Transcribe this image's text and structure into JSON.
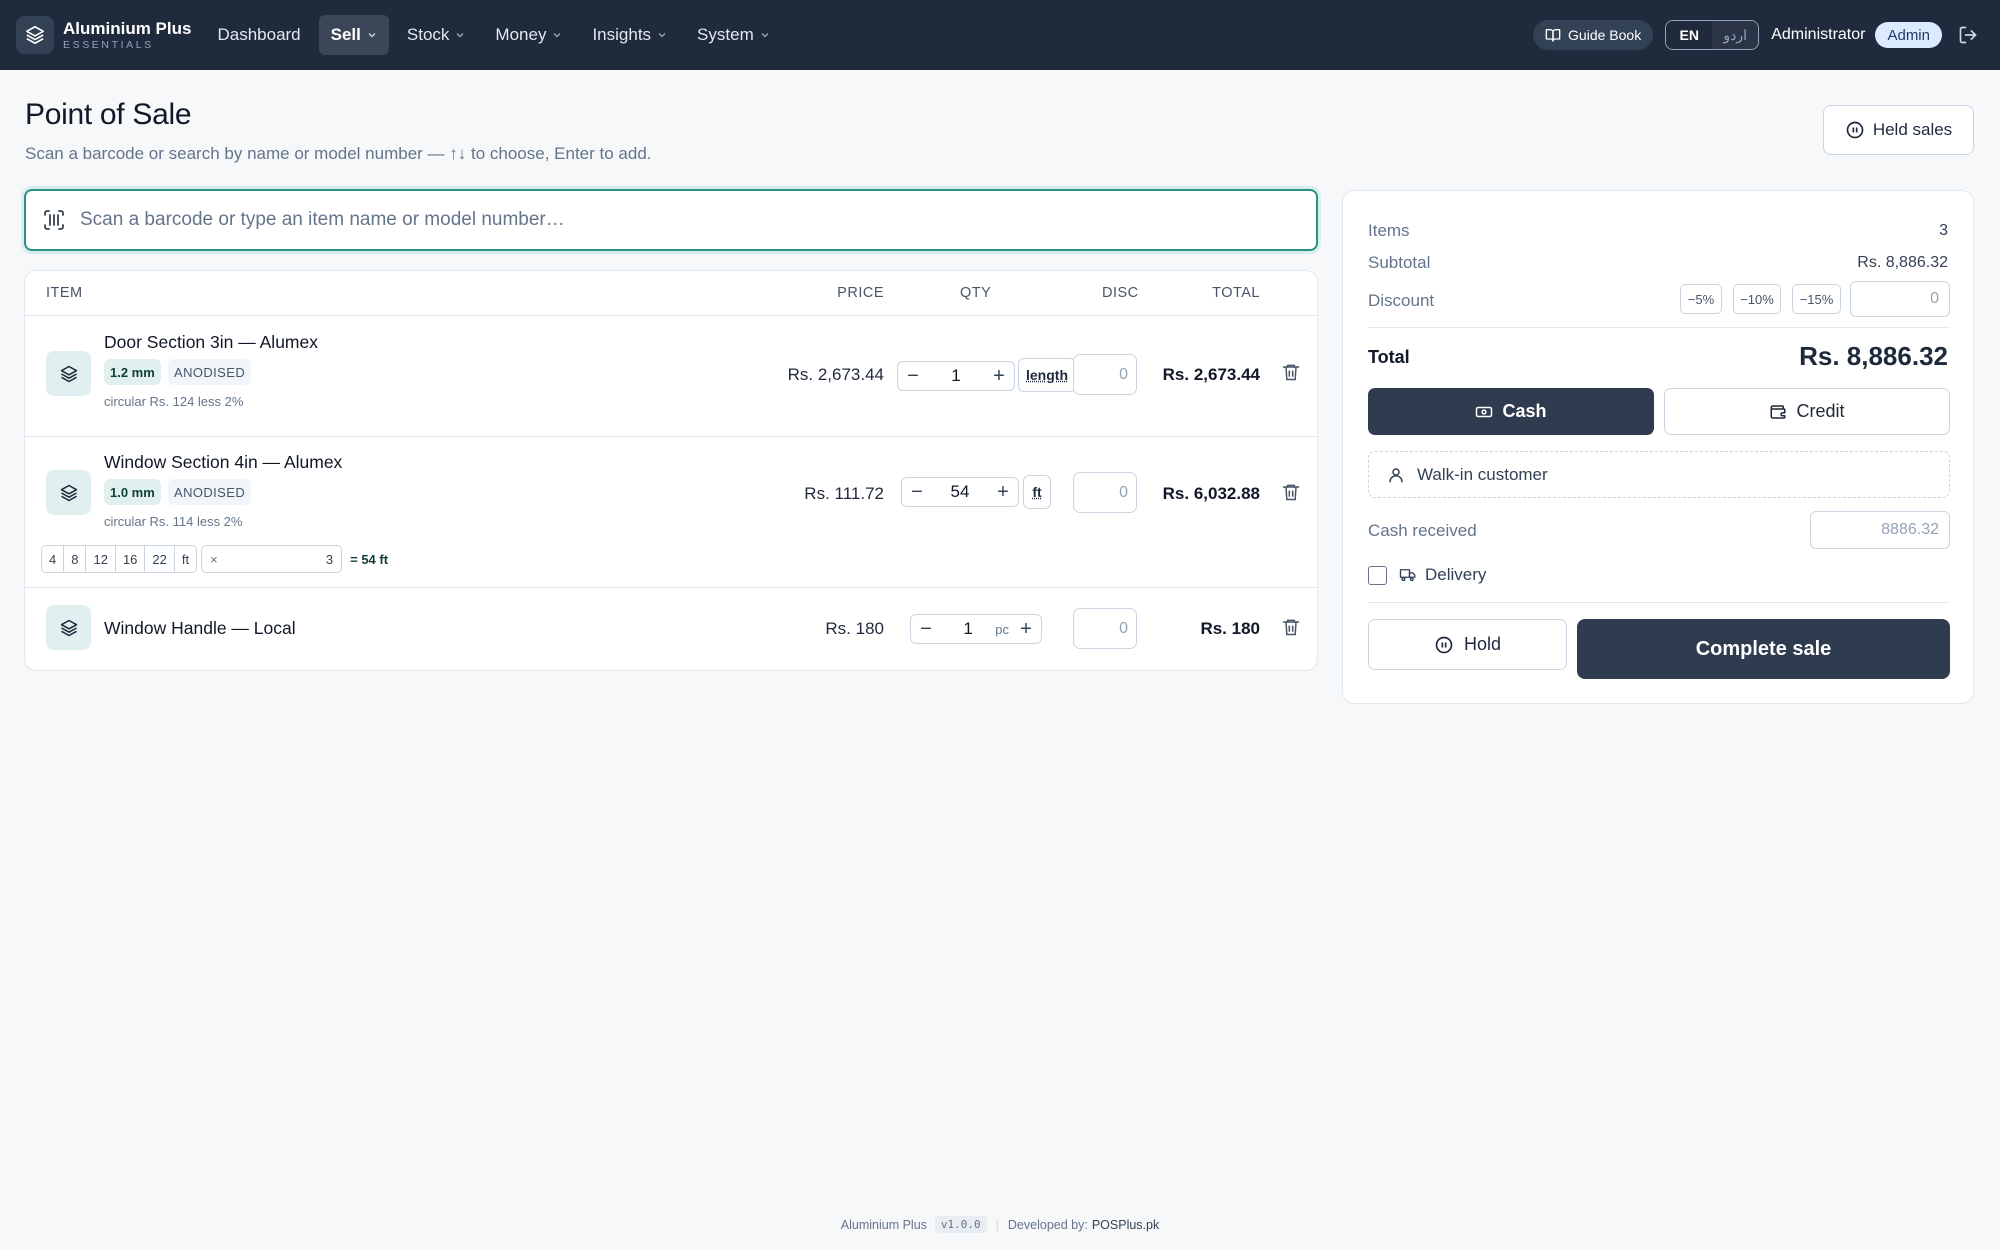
{
  "brand": {
    "name": "Aluminium Plus",
    "sub": "ESSENTIALS"
  },
  "nav": {
    "dashboard": "Dashboard",
    "sell": "Sell",
    "stock": "Stock",
    "money": "Money",
    "insights": "Insights",
    "system": "System"
  },
  "topright": {
    "guide": "Guide Book",
    "lang_en": "EN",
    "lang_ur": "اردو",
    "user": "Administrator",
    "role": "Admin"
  },
  "header": {
    "title": "Point of Sale",
    "subtitle": "Scan a barcode or search by name or model number — ↑↓ to choose, Enter to add.",
    "held_sales": "Held sales"
  },
  "search": {
    "placeholder": "Scan a barcode or type an item name or model number…"
  },
  "cart": {
    "columns": {
      "item": "ITEM",
      "price": "PRICE",
      "qty": "QTY",
      "disc": "DISC",
      "total": "TOTAL"
    },
    "rows": [
      {
        "name": "Door Section 3in — Alumex",
        "thickness": "1.2 mm",
        "finish": "ANODISED",
        "note": "circular Rs. 124 less 2%",
        "price": "Rs. 2,673.44",
        "qty": "1",
        "unit": "length",
        "disc": "0",
        "total": "Rs. 2,673.44"
      },
      {
        "name": "Window Section 4in — Alumex",
        "thickness": "1.0 mm",
        "finish": "ANODISED",
        "note": "circular Rs. 114 less 2%",
        "price": "Rs. 111.72",
        "qty": "54",
        "unit": "ft",
        "disc": "0",
        "total": "Rs. 6,032.88",
        "lengths": [
          "4",
          "8",
          "12",
          "16",
          "22",
          "ft"
        ],
        "multiplier_symbol": "×",
        "multiplier": "3",
        "length_total": "= 54 ft"
      },
      {
        "name": "Window Handle — Local",
        "price": "Rs. 180",
        "qty": "1",
        "unit": "pc",
        "disc": "0",
        "total": "Rs. 180"
      }
    ]
  },
  "summary": {
    "items_label": "Items",
    "items_value": "3",
    "subtotal_label": "Subtotal",
    "subtotal_value": "Rs. 8,886.32",
    "discount_label": "Discount",
    "discount_presets": [
      "−5%",
      "−10%",
      "−15%"
    ],
    "discount_value": "0",
    "total_label": "Total",
    "total_value": "Rs. 8,886.32",
    "cash": "Cash",
    "credit": "Credit",
    "customer": "Walk-in customer",
    "cash_received_label": "Cash received",
    "cash_received_placeholder": "8886.32",
    "delivery": "Delivery",
    "hold": "Hold",
    "complete": "Complete sale"
  },
  "footer": {
    "app": "Aluminium Plus",
    "version": "v1.0.0",
    "dev_label": "Developed by:",
    "dev_name": "POSPlus.pk"
  }
}
